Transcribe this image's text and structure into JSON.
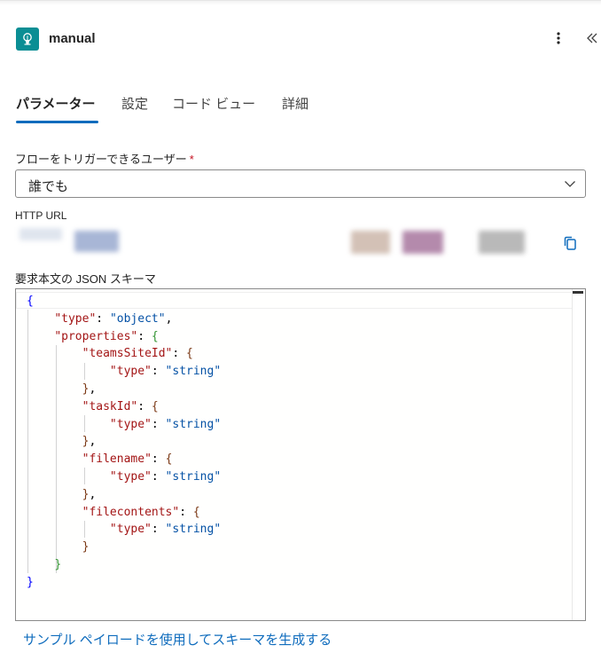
{
  "header": {
    "title": "manual",
    "icon": "touch-trigger-icon",
    "icon_color": "#0b8e94"
  },
  "tabs": [
    {
      "label": "パラメーター",
      "active": true
    },
    {
      "label": "設定",
      "active": false
    },
    {
      "label": "コード ビュー",
      "active": false
    },
    {
      "label": "詳細",
      "active": false
    }
  ],
  "trigger_who": {
    "label": "フローをトリガーできるユーザー",
    "required_mark": "*",
    "selected": "誰でも"
  },
  "http_url": {
    "label": "HTTP URL"
  },
  "schema": {
    "label": "要求本文の JSON スキーマ",
    "lines": [
      "{",
      "    \"type\": \"object\",",
      "    \"properties\": {",
      "        \"teamsSiteId\": {",
      "            \"type\": \"string\"",
      "        },",
      "        \"taskId\": {",
      "            \"type\": \"string\"",
      "        },",
      "        \"filename\": {",
      "            \"type\": \"string\"",
      "        },",
      "        \"filecontents\": {",
      "            \"type\": \"string\"",
      "        }",
      "    }",
      "}"
    ]
  },
  "generate_link": "サンプル ペイロードを使用してスキーマを生成する",
  "colors": {
    "accent": "#0f6cbd",
    "json_key": "#a31515",
    "json_string": "#0451a5"
  }
}
